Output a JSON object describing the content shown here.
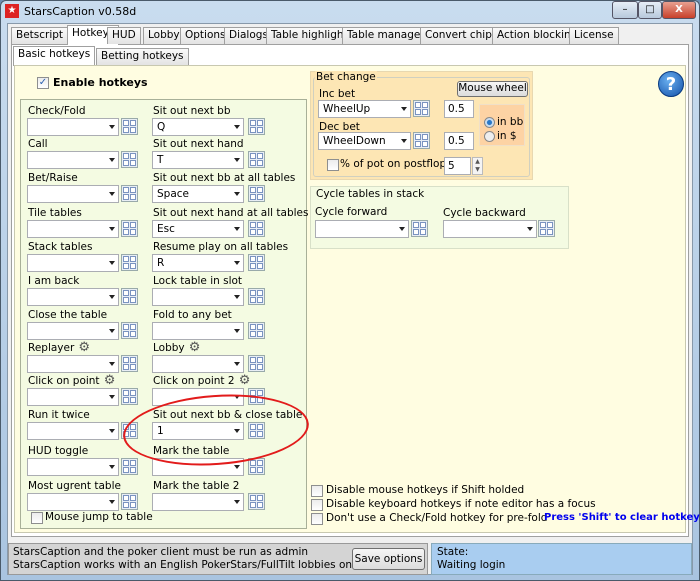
{
  "window": {
    "title": "StarsCaption v0.58d",
    "min": "–",
    "max": "□",
    "close": "X"
  },
  "tabs": [
    "Betscript",
    "Hotkeys",
    "HUD",
    "Lobby",
    "Options",
    "Dialogs",
    "Table highlight",
    "Table manager",
    "Convert chips",
    "Action blocking",
    "License"
  ],
  "active_tab": "Hotkeys",
  "subtabs": [
    "Basic hotkeys",
    "Betting hotkeys"
  ],
  "enable_hotkeys": {
    "label": "Enable hotkeys",
    "checked": true
  },
  "left_hotkeys": [
    {
      "label": "Check/Fold",
      "value": ""
    },
    {
      "label": "Call",
      "value": ""
    },
    {
      "label": "Bet/Raise",
      "value": ""
    },
    {
      "label": "Tile tables",
      "value": ""
    },
    {
      "label": "Stack tables",
      "value": ""
    },
    {
      "label": "I am back",
      "value": ""
    },
    {
      "label": "Close the table",
      "value": ""
    },
    {
      "label": "Replayer",
      "value": "",
      "gear": true
    },
    {
      "label": "Click on point",
      "value": "",
      "gear": true
    },
    {
      "label": "Run it twice",
      "value": ""
    },
    {
      "label": "HUD toggle",
      "value": ""
    },
    {
      "label": "Most ugrent table",
      "value": ""
    }
  ],
  "right_hotkeys": [
    {
      "label": "Sit out next bb",
      "value": "Q"
    },
    {
      "label": "Sit out next hand",
      "value": "T"
    },
    {
      "label": "Sit out next bb at all tables",
      "value": "Space"
    },
    {
      "label": "Sit out next hand at all tables",
      "value": "Esc"
    },
    {
      "label": "Resume play on all tables",
      "value": "R"
    },
    {
      "label": "Lock table in slot",
      "value": ""
    },
    {
      "label": "Fold to any bet",
      "value": ""
    },
    {
      "label": "Lobby",
      "value": "",
      "gear": true
    },
    {
      "label": "Click on point 2",
      "value": "",
      "gear": true
    },
    {
      "label": "Sit out next bb & close table",
      "value": "1"
    },
    {
      "label": "Mark the table",
      "value": ""
    },
    {
      "label": "Mark the table 2",
      "value": ""
    }
  ],
  "mouse_jump": {
    "label": "Mouse jump to table",
    "checked": false
  },
  "bet_change": {
    "title": "Bet change",
    "mouse_wheel": "Mouse wheel",
    "inc_label": "Inc bet",
    "inc_value": "WheelUp",
    "inc_amount": "0.5",
    "dec_label": "Dec bet",
    "dec_value": "WheelDown",
    "dec_amount": "0.5",
    "in_bb": "in bb",
    "in_dollar": "in $",
    "pct_label": "% of pot on postflop",
    "pct_value": "5"
  },
  "cycle": {
    "title": "Cycle tables in stack",
    "forward": "Cycle forward",
    "backward": "Cycle backward"
  },
  "options": [
    "Disable mouse hotkeys if Shift holded",
    "Disable keyboard hotkeys if note editor has a focus",
    "Don't use a Check/Fold hotkey for pre-fold"
  ],
  "hint": "Press 'Shift' to clear hotkey",
  "status": {
    "line1": "StarsCaption and the poker client must be run as admin",
    "line2": "StarsCaption works with an English PokerStars/FullTilt lobbies only",
    "save": "Save options",
    "state_label": "State:",
    "state_value": "Waiting login"
  },
  "colors": {
    "hint": "#0000ee",
    "annotation": "#e21b1b"
  }
}
